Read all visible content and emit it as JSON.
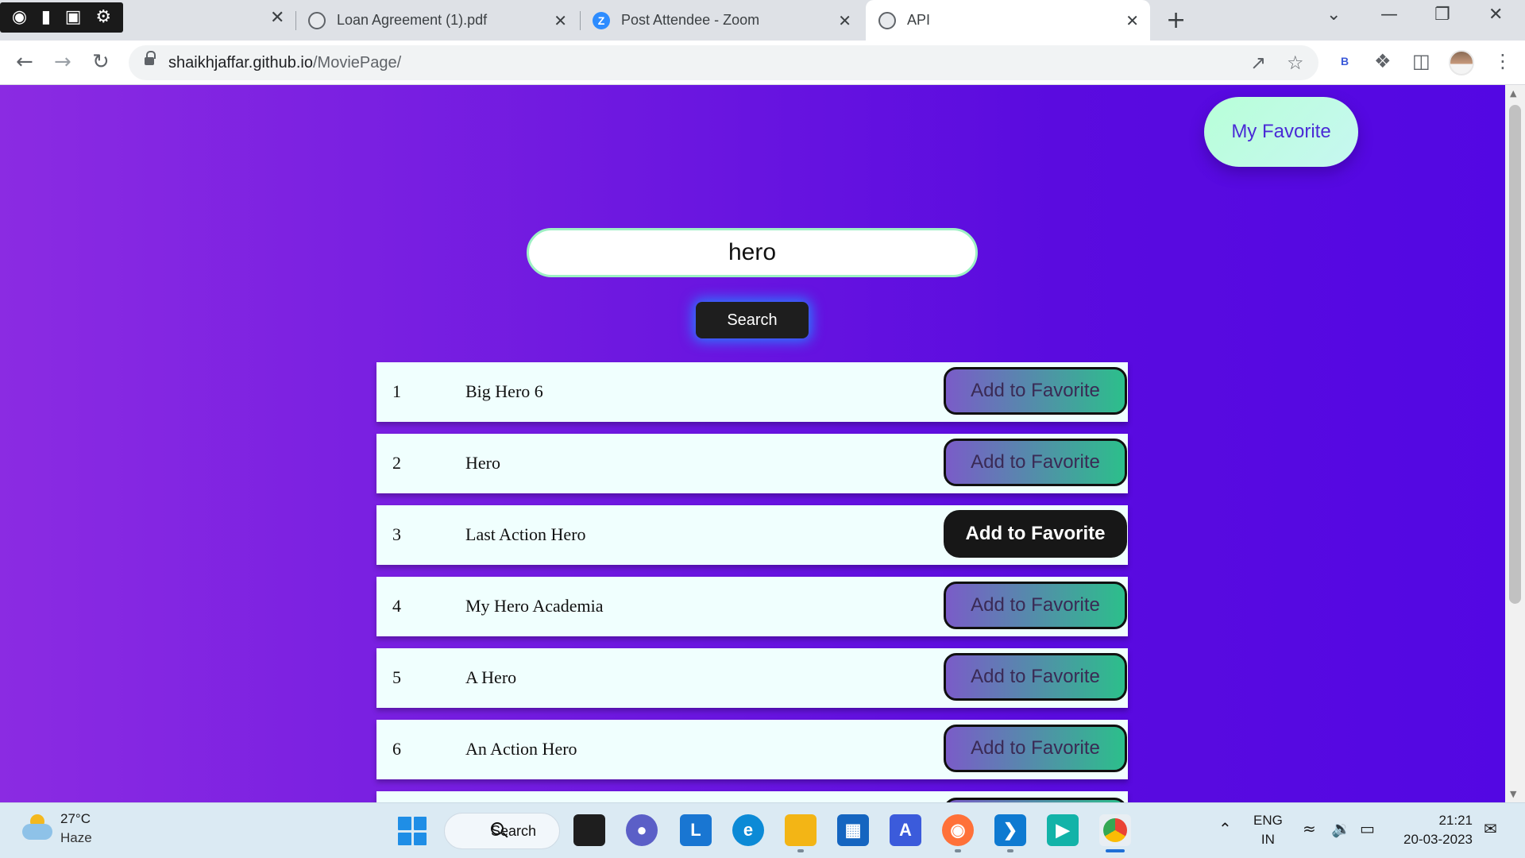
{
  "browser": {
    "tabs": [
      {
        "label": "",
        "icon": "capture-toolbar"
      },
      {
        "label": "Loan Agreement (1).pdf",
        "icon": "globe-icon"
      },
      {
        "label": "Post Attendee - Zoom",
        "icon": "zoom-icon"
      },
      {
        "label": "API",
        "icon": "globe-icon",
        "active": true
      }
    ],
    "url_host": "shaikhjaffar.github.io",
    "url_path": "/MoviePage/",
    "profile_extension_label": "B"
  },
  "page": {
    "favorite_button": "My Favorite",
    "search_value": "hero",
    "search_button": "Search",
    "results": [
      {
        "num": "1",
        "title": "Big Hero 6",
        "action": "Add to Favorite"
      },
      {
        "num": "2",
        "title": "Hero",
        "action": "Add to Favorite"
      },
      {
        "num": "3",
        "title": "Last Action Hero",
        "action": "Add to Favorite",
        "hovered": true
      },
      {
        "num": "4",
        "title": "My Hero Academia",
        "action": "Add to Favorite"
      },
      {
        "num": "5",
        "title": "A Hero",
        "action": "Add to Favorite"
      },
      {
        "num": "6",
        "title": "An Action Hero",
        "action": "Add to Favorite"
      }
    ],
    "colors": {
      "background_start": "#8b2be2",
      "background_end": "#5307e3",
      "favorite_button": "#b8ffd8",
      "add_button_start": "#7a5cc8",
      "add_button_end": "#2cbf8b"
    }
  },
  "taskbar": {
    "weather_temp": "27°C",
    "weather_desc": "Haze",
    "search_label": "Search",
    "language": "ENG",
    "region": "IN",
    "time": "21:21",
    "date": "20-03-2023"
  }
}
